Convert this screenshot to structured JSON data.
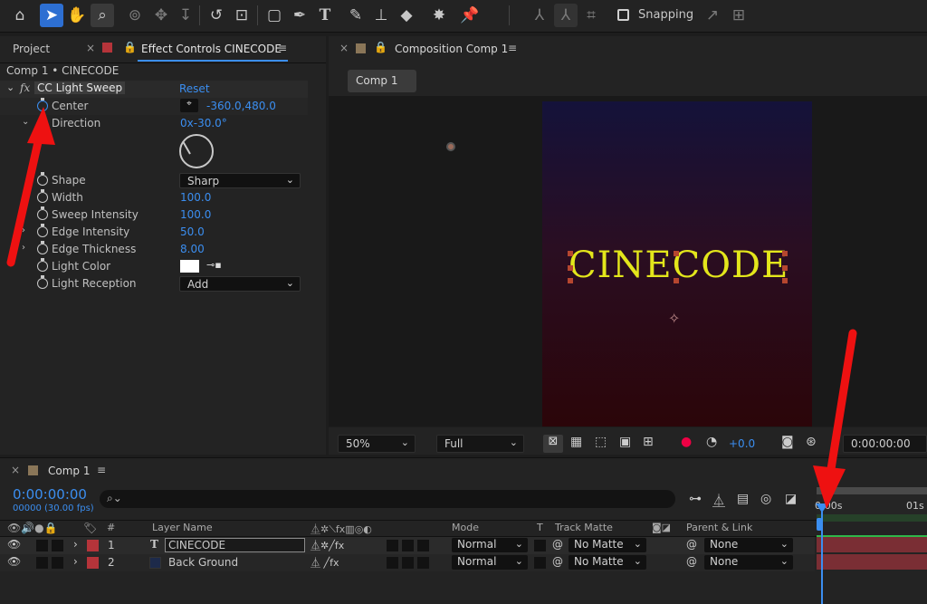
{
  "toolbar": {
    "icons": [
      "home-icon",
      "selection-tool-icon",
      "hand-tool-icon",
      "zoom-tool-icon",
      "orbit-camera-icon",
      "pan-camera-icon",
      "dolly-camera-icon",
      "rotation-tool-icon",
      "pan-behind-icon",
      "rectangle-tool-icon",
      "pen-tool-icon",
      "type-tool-icon",
      "brush-tool-icon",
      "clone-stamp-icon",
      "eraser-icon",
      "roto-brush-icon",
      "puppet-pin-icon",
      "axis-local-icon",
      "axis-world-icon",
      "axis-view-icon"
    ],
    "snapping_label": "Snapping"
  },
  "left_panel": {
    "tab_project": "Project",
    "tab_effect_controls": "Effect Controls CINECODE",
    "breadcrumb": "Comp 1 • CINECODE",
    "effect_fx": "fx",
    "effect_name": "CC Light Sweep",
    "reset_label": "Reset",
    "properties": [
      {
        "label": "Center",
        "value": "-360.0,480.0"
      },
      {
        "label": "Direction",
        "value": "0x-30.0°"
      },
      {
        "label": "Shape",
        "value": "Sharp"
      },
      {
        "label": "Width",
        "value": "100.0"
      },
      {
        "label": "Sweep Intensity",
        "value": "100.0"
      },
      {
        "label": "Edge Intensity",
        "value": "50.0"
      },
      {
        "label": "Edge Thickness",
        "value": "8.00"
      },
      {
        "label": "Light Color",
        "value": "#ffffff"
      },
      {
        "label": "Light Reception",
        "value": "Add"
      }
    ]
  },
  "composition_panel": {
    "tab_label": "Composition Comp 1",
    "comp_button": "Comp 1",
    "text_layer": "CINECODE",
    "zoom": "50%",
    "resolution": "Full",
    "exposure": "+0.0",
    "timecode": "0:00:00:00"
  },
  "timeline": {
    "tab_label": "Comp 1",
    "timecode": "0:00:00:00",
    "frame_info": "00000 (30.00 fps)",
    "search_placeholder": "",
    "col_num": "#",
    "col_layer_name": "Layer Name",
    "col_mode": "Mode",
    "col_t": "T",
    "col_track_matte": "Track Matte",
    "col_parent": "Parent & Link",
    "ruler_start": "0:00s",
    "ruler_1s": "01s",
    "layers": [
      {
        "num": "1",
        "type": "T",
        "name": "CINECODE",
        "mode": "Normal",
        "matte": "No Matte",
        "parent": "None"
      },
      {
        "num": "2",
        "type": "",
        "name": "Back Ground",
        "mode": "Normal",
        "matte": "No Matte",
        "parent": "None"
      }
    ]
  },
  "colors": {
    "accent_blue": "#3b8ef0",
    "label_red": "#b5343a",
    "text_yellow": "#e3e61b",
    "arrow_red": "#ee1111"
  }
}
